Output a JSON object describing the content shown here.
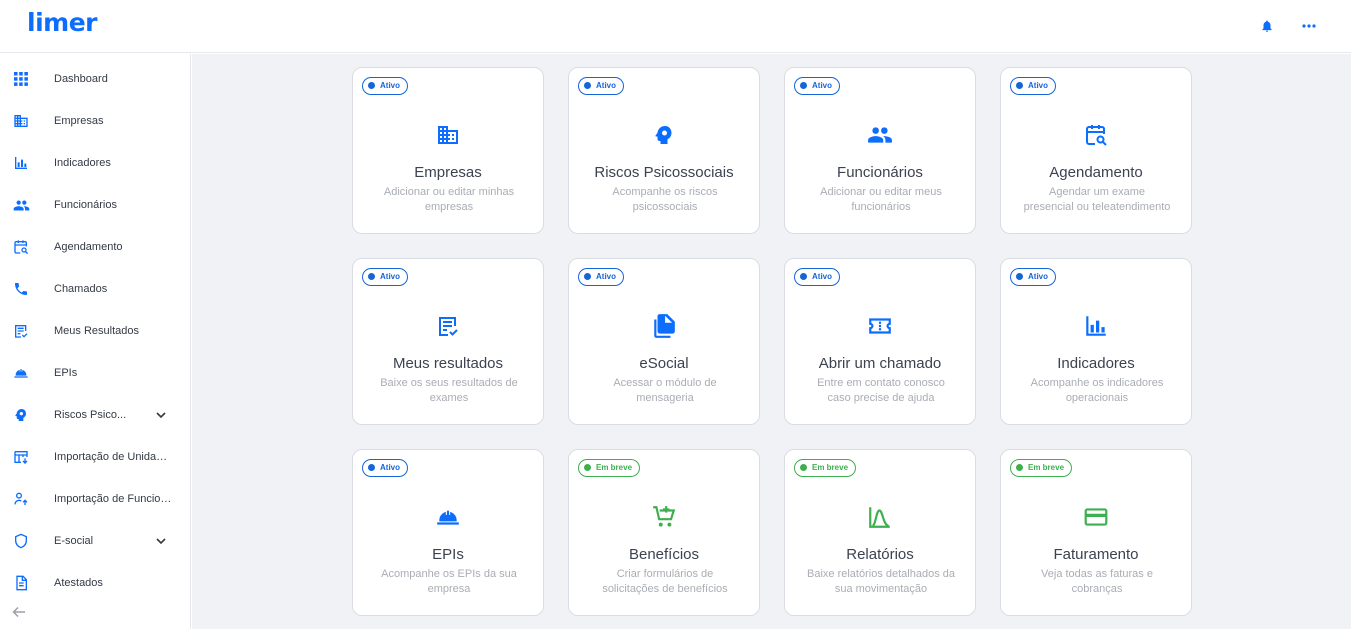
{
  "header": {
    "logo": "limer",
    "notification_icon": "bell-icon",
    "more_icon": "more-horizontal-icon"
  },
  "colors": {
    "brand": "#0d6efd",
    "active": "#1565d8",
    "soon": "#3eaf4f",
    "main_bg": "#f1f2f6"
  },
  "sidebar": {
    "items": [
      {
        "label": "Dashboard",
        "icon": "grid-icon"
      },
      {
        "label": "Empresas",
        "icon": "building-icon"
      },
      {
        "label": "Indicadores",
        "icon": "bar-chart-icon"
      },
      {
        "label": "Funcionários",
        "icon": "people-icon"
      },
      {
        "label": "Agendamento",
        "icon": "calendar-search-icon"
      },
      {
        "label": "Chamados",
        "icon": "phone-icon"
      },
      {
        "label": "Meus Resultados",
        "icon": "document-check-icon"
      },
      {
        "label": "EPIs",
        "icon": "helmet-icon"
      },
      {
        "label": "Riscos Psico...",
        "icon": "brain-icon",
        "expandable": true
      },
      {
        "label": "Importação de Unidades",
        "icon": "table-import-icon"
      },
      {
        "label": "Importação de Funcion...",
        "icon": "person-upload-icon"
      },
      {
        "label": "E-social",
        "icon": "shield-icon",
        "expandable": true
      },
      {
        "label": "Atestados",
        "icon": "document-icon"
      }
    ],
    "collapse_icon": "arrow-left-icon"
  },
  "cards": [
    {
      "status": "Ativo",
      "title": "Empresas",
      "desc": "Adicionar ou editar minhas empresas",
      "icon": "building-icon"
    },
    {
      "status": "Ativo",
      "title": "Riscos Psicossociais",
      "desc": "Acompanhe os riscos psicossociais",
      "icon": "brain-icon"
    },
    {
      "status": "Ativo",
      "title": "Funcionários",
      "desc": "Adicionar ou editar meus funcionários",
      "icon": "people-icon"
    },
    {
      "status": "Ativo",
      "title": "Agendamento",
      "desc": "Agendar um exame presencial ou teleatendimento",
      "icon": "calendar-search-icon"
    },
    {
      "status": "Ativo",
      "title": "Meus resultados",
      "desc": "Baixe os seus resultados de exames",
      "icon": "document-check-icon"
    },
    {
      "status": "Ativo",
      "title": "eSocial",
      "desc": "Acessar o módulo de mensageria",
      "icon": "file-stack-icon"
    },
    {
      "status": "Ativo",
      "title": "Abrir um chamado",
      "desc": "Entre em contato conosco caso precise de ajuda",
      "icon": "ticket-icon"
    },
    {
      "status": "Ativo",
      "title": "Indicadores",
      "desc": "Acompanhe os indicadores operacionais",
      "icon": "bar-chart-icon"
    },
    {
      "status": "Ativo",
      "title": "EPIs",
      "desc": "Acompanhe os EPIs da sua empresa",
      "icon": "helmet-icon"
    },
    {
      "status": "Em breve",
      "title": "Benefícios",
      "desc": "Criar formulários de solicitações de benefícios",
      "icon": "cart-add-icon"
    },
    {
      "status": "Em breve",
      "title": "Relatórios",
      "desc": "Baixe relatórios detalhados da sua movimentação",
      "icon": "bell-curve-icon"
    },
    {
      "status": "Em breve",
      "title": "Faturamento",
      "desc": "Veja todas as faturas e cobranças",
      "icon": "credit-card-icon"
    }
  ]
}
